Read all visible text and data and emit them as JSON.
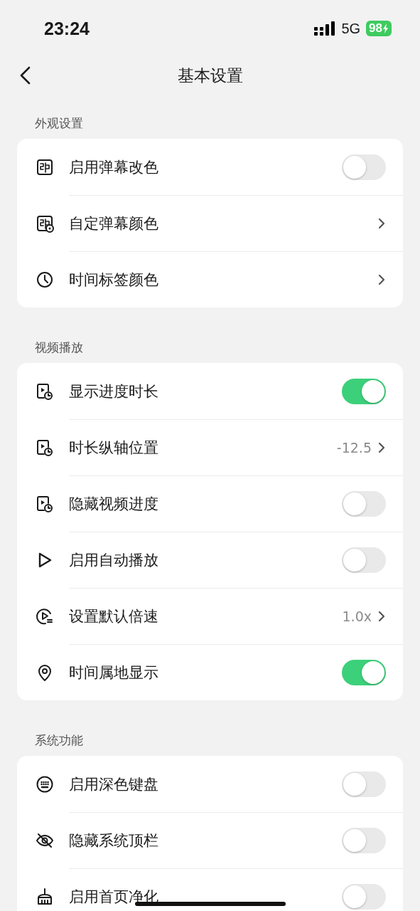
{
  "status_bar": {
    "time": "23:24",
    "network": "5G",
    "battery": "98"
  },
  "header": {
    "title": "基本设置"
  },
  "sections": [
    {
      "title": "外观设置",
      "rows": [
        {
          "kind": "toggle",
          "label": "启用弹幕改色",
          "on": false
        },
        {
          "kind": "link",
          "label": "自定弹幕颜色"
        },
        {
          "kind": "link",
          "label": "时间标签颜色"
        }
      ]
    },
    {
      "title": "视频播放",
      "rows": [
        {
          "kind": "toggle",
          "label": "显示进度时长",
          "on": true
        },
        {
          "kind": "link",
          "label": "时长纵轴位置",
          "value": "-12.5"
        },
        {
          "kind": "toggle",
          "label": "隐藏视频进度",
          "on": false
        },
        {
          "kind": "toggle",
          "label": "启用自动播放",
          "on": false
        },
        {
          "kind": "link",
          "label": "设置默认倍速",
          "value": "1.0x"
        },
        {
          "kind": "toggle",
          "label": "时间属地显示",
          "on": true
        }
      ]
    },
    {
      "title": "系统功能",
      "rows": [
        {
          "kind": "toggle",
          "label": "启用深色键盘",
          "on": false
        },
        {
          "kind": "toggle",
          "label": "隐藏系统顶栏",
          "on": false
        },
        {
          "kind": "toggle",
          "label": "启用首页净化",
          "on": false
        }
      ]
    }
  ]
}
